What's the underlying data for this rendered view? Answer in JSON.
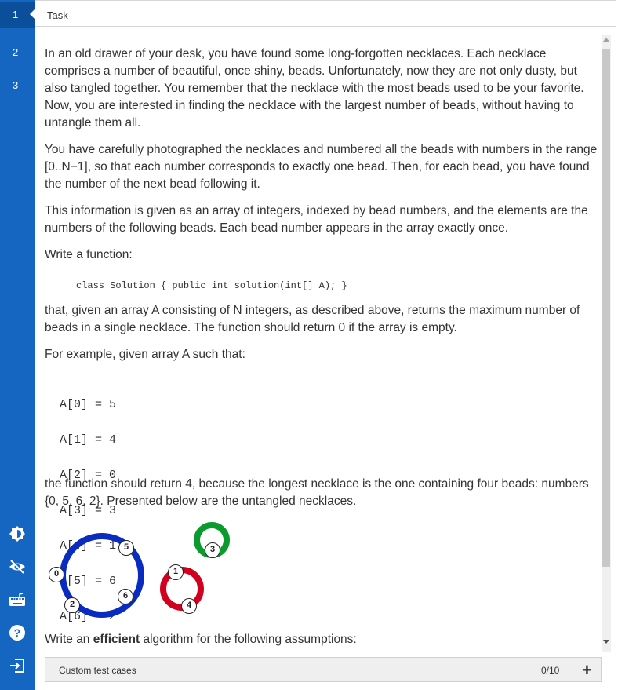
{
  "sidebar": {
    "tabs": [
      {
        "label": "1",
        "active": true
      },
      {
        "label": "2",
        "active": false
      },
      {
        "label": "3",
        "active": false
      }
    ],
    "icons": [
      "contrast-icon",
      "visibility-icon",
      "keyboard-icon",
      "help-icon",
      "exit-icon"
    ]
  },
  "task_tab": {
    "label": "Task"
  },
  "content": {
    "p1": "In an old drawer of your desk, you have found some long-forgotten necklaces. Each necklace comprises a number of beautiful, once shiny, beads. Unfortunately, now they are not only dusty, but also tangled together. You remember that the necklace with the most beads used to be your favorite. Now, you are interested in finding the necklace with the largest number of beads, without having to untangle them all.",
    "p2": "You have carefully photographed the necklaces and numbered all the beads with numbers in the range [0..N−1], so that each number corresponds to exactly one bead. Then, for each bead, you have found the number of the next bead following it.",
    "p3": "This information is given as an array of integers, indexed by bead numbers, and the elements are the numbers of the following beads. Each bead number appears in the array exactly once.",
    "p4": "Write a function:",
    "code": "class Solution { public int solution(int[] A); }",
    "p5": "that, given an array A consisting of N integers, as described above, returns the maximum number of beads in a single necklace. The function should return 0 if the array is empty.",
    "p6": "For example, given array A such that:",
    "array_lines": [
      "A[0] = 5",
      "A[1] = 4",
      "A[2] = 0",
      "A[3] = 3",
      "A[4] = 1",
      "A[5] = 6",
      "A[6] = 2"
    ],
    "p7": "the function should return 4, because the longest necklace is the one containing four beads: numbers {0, 5, 6, 2}. Presented below are the untangled necklaces.",
    "p8_prefix": "Write an ",
    "p8_bold": "efficient",
    "p8_suffix": " algorithm for the following assumptions:"
  },
  "diagram": {
    "nodes": [
      "0",
      "5",
      "6",
      "2",
      "3",
      "1",
      "4"
    ],
    "colors": {
      "blue": "#0a2bbf",
      "green": "#0b9a2e",
      "red": "#d2001f"
    }
  },
  "bottom_bar": {
    "label": "Custom test cases",
    "count": "0/10",
    "add": "+"
  }
}
